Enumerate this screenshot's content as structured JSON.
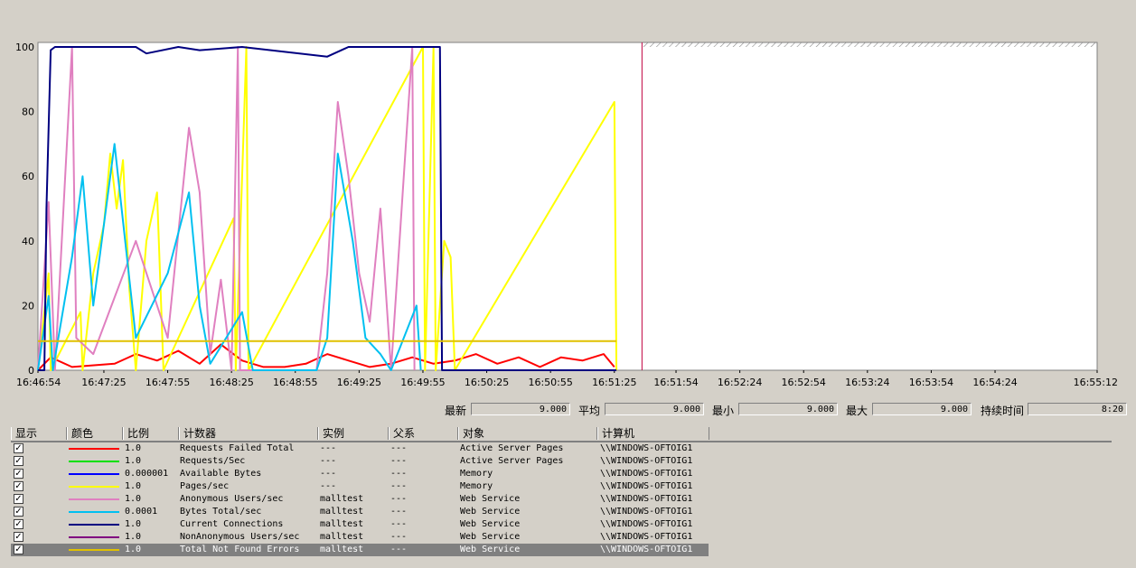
{
  "chart_data": {
    "type": "line",
    "ylim": [
      0,
      100
    ],
    "yticks": [
      "100",
      "80",
      "60",
      "40",
      "20",
      "0"
    ],
    "xticks": [
      "16:46:54",
      "16:47:25",
      "16:47:55",
      "16:48:25",
      "16:48:55",
      "16:49:25",
      "16:49:55",
      "16:50:25",
      "16:50:55",
      "16:51:25",
      "16:51:54",
      "16:52:24",
      "16:52:54",
      "16:53:24",
      "16:53:54",
      "16:54:24",
      "16:55:12"
    ],
    "time_range": [
      "16:46:54",
      "16:55:12"
    ],
    "current_time": "16:51:38",
    "series": [
      {
        "name": "Requests Failed Total",
        "color": "#ff0000",
        "points": [
          [
            "16:46:54",
            0
          ],
          [
            "16:47:00",
            4
          ],
          [
            "16:47:10",
            1
          ],
          [
            "16:47:30",
            2
          ],
          [
            "16:47:40",
            5
          ],
          [
            "16:47:50",
            3
          ],
          [
            "16:48:00",
            6
          ],
          [
            "16:48:10",
            2
          ],
          [
            "16:48:20",
            8
          ],
          [
            "16:48:30",
            3
          ],
          [
            "16:48:40",
            1
          ],
          [
            "16:48:50",
            1
          ],
          [
            "16:49:00",
            2
          ],
          [
            "16:49:10",
            5
          ],
          [
            "16:49:20",
            3
          ],
          [
            "16:49:30",
            1
          ],
          [
            "16:49:40",
            2
          ],
          [
            "16:49:50",
            4
          ],
          [
            "16:50:00",
            2
          ],
          [
            "16:50:10",
            3
          ],
          [
            "16:50:20",
            5
          ],
          [
            "16:50:30",
            2
          ],
          [
            "16:50:40",
            4
          ],
          [
            "16:50:50",
            1
          ],
          [
            "16:51:00",
            4
          ],
          [
            "16:51:10",
            3
          ],
          [
            "16:51:20",
            5
          ],
          [
            "16:51:25",
            1
          ]
        ]
      },
      {
        "name": "Pages/sec",
        "color": "#ffff00",
        "points": [
          [
            "16:46:54",
            0
          ],
          [
            "16:46:59",
            30
          ],
          [
            "16:47:00",
            0
          ],
          [
            "16:47:14",
            18
          ],
          [
            "16:47:15",
            0
          ],
          [
            "16:47:20",
            30
          ],
          [
            "16:47:25",
            45
          ],
          [
            "16:47:28",
            67
          ],
          [
            "16:47:31",
            50
          ],
          [
            "16:47:34",
            65
          ],
          [
            "16:47:37",
            25
          ],
          [
            "16:47:40",
            0
          ],
          [
            "16:47:45",
            40
          ],
          [
            "16:47:50",
            55
          ],
          [
            "16:47:53",
            0
          ],
          [
            "16:48:26",
            47
          ],
          [
            "16:48:27",
            0
          ],
          [
            "16:48:32",
            100
          ],
          [
            "16:48:33",
            0
          ],
          [
            "16:49:55",
            100
          ],
          [
            "16:49:56",
            0
          ],
          [
            "16:50:00",
            100
          ],
          [
            "16:50:01",
            0
          ],
          [
            "16:50:05",
            40
          ],
          [
            "16:50:08",
            35
          ],
          [
            "16:50:10",
            0
          ],
          [
            "16:51:25",
            83
          ],
          [
            "16:51:26",
            0
          ]
        ]
      },
      {
        "name": "Anonymous Users/sec",
        "color": "#e080c0",
        "points": [
          [
            "16:46:54",
            0
          ],
          [
            "16:46:59",
            52
          ],
          [
            "16:47:02",
            0
          ],
          [
            "16:47:10",
            100
          ],
          [
            "16:47:12",
            10
          ],
          [
            "16:47:20",
            5
          ],
          [
            "16:47:40",
            40
          ],
          [
            "16:47:55",
            10
          ],
          [
            "16:48:05",
            75
          ],
          [
            "16:48:10",
            55
          ],
          [
            "16:48:15",
            5
          ],
          [
            "16:48:20",
            28
          ],
          [
            "16:48:25",
            0
          ],
          [
            "16:48:28",
            100
          ],
          [
            "16:48:29",
            0
          ],
          [
            "16:49:05",
            0
          ],
          [
            "16:49:10",
            30
          ],
          [
            "16:49:15",
            83
          ],
          [
            "16:49:20",
            60
          ],
          [
            "16:49:25",
            30
          ],
          [
            "16:49:30",
            15
          ],
          [
            "16:49:35",
            50
          ],
          [
            "16:49:40",
            0
          ],
          [
            "16:49:50",
            100
          ],
          [
            "16:49:51",
            0
          ]
        ]
      },
      {
        "name": "Bytes Total/sec",
        "color": "#00c0f0",
        "points": [
          [
            "16:46:54",
            0
          ],
          [
            "16:46:59",
            23
          ],
          [
            "16:47:01",
            0
          ],
          [
            "16:47:10",
            35
          ],
          [
            "16:47:15",
            60
          ],
          [
            "16:47:20",
            20
          ],
          [
            "16:47:30",
            70
          ],
          [
            "16:47:35",
            40
          ],
          [
            "16:47:40",
            10
          ],
          [
            "16:47:55",
            30
          ],
          [
            "16:48:05",
            55
          ],
          [
            "16:48:10",
            20
          ],
          [
            "16:48:15",
            2
          ],
          [
            "16:48:30",
            18
          ],
          [
            "16:48:35",
            0
          ],
          [
            "16:49:05",
            0
          ],
          [
            "16:49:10",
            10
          ],
          [
            "16:49:15",
            67
          ],
          [
            "16:49:22",
            40
          ],
          [
            "16:49:28",
            10
          ],
          [
            "16:49:35",
            5
          ],
          [
            "16:49:40",
            0
          ],
          [
            "16:49:52",
            20
          ],
          [
            "16:49:54",
            0
          ]
        ]
      },
      {
        "name": "Current Connections",
        "color": "#000080",
        "points": [
          [
            "16:46:54",
            0
          ],
          [
            "16:46:57",
            0
          ],
          [
            "16:46:58",
            50
          ],
          [
            "16:47:00",
            99
          ],
          [
            "16:47:02",
            100
          ],
          [
            "16:47:40",
            100
          ],
          [
            "16:47:45",
            98
          ],
          [
            "16:48:00",
            100
          ],
          [
            "16:48:10",
            99
          ],
          [
            "16:48:30",
            100
          ],
          [
            "16:49:10",
            97
          ],
          [
            "16:49:20",
            100
          ],
          [
            "16:50:03",
            100
          ],
          [
            "16:50:04",
            0
          ],
          [
            "16:51:26",
            0
          ]
        ]
      },
      {
        "name": "Total Not Found Errors",
        "color": "#e0c000",
        "points": [
          [
            "16:46:54",
            9
          ],
          [
            "16:51:26",
            9
          ]
        ]
      }
    ]
  },
  "stats": {
    "last_label": "最新",
    "last_value": "9.000",
    "avg_label": "平均",
    "avg_value": "9.000",
    "min_label": "最小",
    "min_value": "9.000",
    "max_label": "最大",
    "max_value": "9.000",
    "dur_label": "持续时间",
    "dur_value": "8:20"
  },
  "legend": {
    "headers": [
      "显示",
      "颜色",
      "比例",
      "计数器",
      "实例",
      "父系",
      "对象",
      "计算机"
    ],
    "rows": [
      {
        "color": "#ff0000",
        "scale": "1.0",
        "counter": "Requests Failed Total",
        "instance": "---",
        "parent": "---",
        "object": "Active Server Pages",
        "computer": "\\\\WINDOWS-OFTOIG1"
      },
      {
        "color": "#00e000",
        "scale": "1.0",
        "counter": "Requests/Sec",
        "instance": "---",
        "parent": "---",
        "object": "Active Server Pages",
        "computer": "\\\\WINDOWS-OFTOIG1"
      },
      {
        "color": "#0000ff",
        "scale": "0.000001",
        "counter": "Available Bytes",
        "instance": "---",
        "parent": "---",
        "object": "Memory",
        "computer": "\\\\WINDOWS-OFTOIG1"
      },
      {
        "color": "#ffff00",
        "scale": "1.0",
        "counter": "Pages/sec",
        "instance": "---",
        "parent": "---",
        "object": "Memory",
        "computer": "\\\\WINDOWS-OFTOIG1"
      },
      {
        "color": "#e080c0",
        "scale": "1.0",
        "counter": "Anonymous Users/sec",
        "instance": "malltest",
        "parent": "---",
        "object": "Web Service",
        "computer": "\\\\WINDOWS-OFTOIG1"
      },
      {
        "color": "#00c0f0",
        "scale": "0.0001",
        "counter": "Bytes Total/sec",
        "instance": "malltest",
        "parent": "---",
        "object": "Web Service",
        "computer": "\\\\WINDOWS-OFTOIG1"
      },
      {
        "color": "#000080",
        "scale": "1.0",
        "counter": "Current Connections",
        "instance": "malltest",
        "parent": "---",
        "object": "Web Service",
        "computer": "\\\\WINDOWS-OFTOIG1"
      },
      {
        "color": "#800080",
        "scale": "1.0",
        "counter": "NonAnonymous Users/sec",
        "instance": "malltest",
        "parent": "---",
        "object": "Web Service",
        "computer": "\\\\WINDOWS-OFTOIG1"
      },
      {
        "color": "#e0c000",
        "scale": "1.0",
        "counter": "Total Not Found Errors",
        "instance": "malltest",
        "parent": "---",
        "object": "Web Service",
        "computer": "\\\\WINDOWS-OFTOIG1",
        "selected": true
      }
    ]
  }
}
